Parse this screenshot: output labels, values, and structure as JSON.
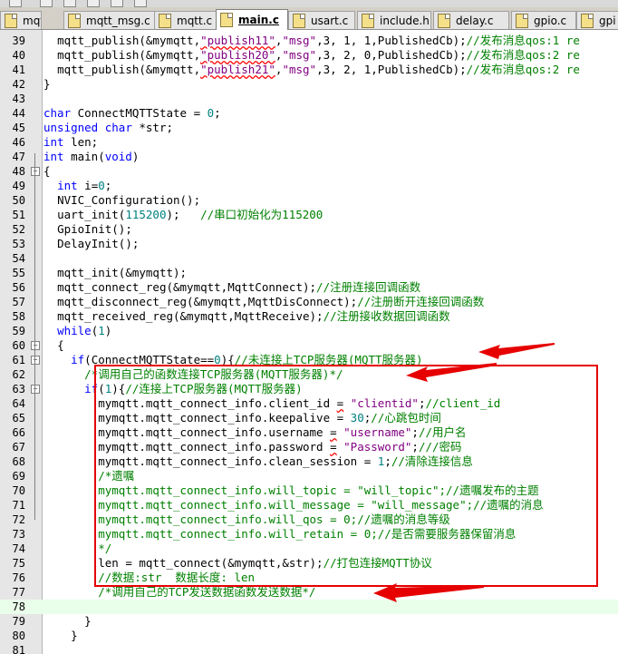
{
  "tabs": [
    {
      "label": "mqtt.h",
      "active": false
    },
    {
      "label": "mqtt_msg.c",
      "active": false
    },
    {
      "label": "mqtt.c",
      "active": false
    },
    {
      "label": "main.c",
      "active": true
    },
    {
      "label": "usart.c",
      "active": false
    },
    {
      "label": "include.h",
      "active": false
    },
    {
      "label": "delay.c",
      "active": false
    },
    {
      "label": "gpio.c",
      "active": false
    },
    {
      "label": "gpi",
      "active": false
    }
  ],
  "file_icon_color": "#f5e08a",
  "accent_color": "#e60000",
  "current_line": 78,
  "lines": [
    {
      "n": "39",
      "indent": "  ",
      "tokens": [
        [
          "mqtt_publish(&mymqtt,",
          ""
        ],
        [
          "\"publish11\"",
          "str sq"
        ],
        [
          ",",
          ""
        ],
        [
          "\"msg\"",
          "str"
        ],
        [
          ",3, 1, 1,PublishedCb);",
          ""
        ],
        [
          "//发布消息qos:1 re",
          "cm"
        ]
      ]
    },
    {
      "n": "40",
      "indent": "  ",
      "tokens": [
        [
          "mqtt_publish(&mymqtt,",
          ""
        ],
        [
          "\"publish20\"",
          "str sq"
        ],
        [
          ",",
          ""
        ],
        [
          "\"msg\"",
          "str"
        ],
        [
          ",3, 2, 0,PublishedCb);",
          ""
        ],
        [
          "//发布消息qos:2 re",
          "cm"
        ]
      ]
    },
    {
      "n": "41",
      "indent": "  ",
      "tokens": [
        [
          "mqtt_publish(&mymqtt,",
          ""
        ],
        [
          "\"publish21\"",
          "str sq"
        ],
        [
          ",",
          ""
        ],
        [
          "\"msg\"",
          "str"
        ],
        [
          ",3, 2, 1,PublishedCb);",
          ""
        ],
        [
          "//发布消息qos:2 re",
          "cm"
        ]
      ]
    },
    {
      "n": "42",
      "indent": "",
      "tokens": [
        [
          "}",
          ""
        ]
      ]
    },
    {
      "n": "43",
      "indent": "",
      "tokens": []
    },
    {
      "n": "44",
      "indent": "",
      "tokens": [
        [
          "char",
          "kw"
        ],
        [
          " ConnectMQTTState = ",
          ""
        ],
        [
          "0",
          "num"
        ],
        [
          ";",
          ""
        ]
      ]
    },
    {
      "n": "45",
      "indent": "",
      "tokens": [
        [
          "unsigned",
          "kw"
        ],
        [
          " ",
          ""
        ],
        [
          "char",
          "kw"
        ],
        [
          " *str;",
          ""
        ]
      ]
    },
    {
      "n": "46",
      "indent": "",
      "tokens": [
        [
          "int",
          "kw"
        ],
        [
          " len;",
          ""
        ]
      ]
    },
    {
      "n": "47",
      "indent": "",
      "tokens": [
        [
          "int",
          "kw"
        ],
        [
          " main(",
          ""
        ],
        [
          "void",
          "kw"
        ],
        [
          ")",
          ""
        ]
      ]
    },
    {
      "n": "48",
      "indent": "",
      "tokens": [
        [
          "{",
          ""
        ]
      ]
    },
    {
      "n": "49",
      "indent": "  ",
      "tokens": [
        [
          "int",
          "kw"
        ],
        [
          " i=",
          ""
        ],
        [
          "0",
          "num"
        ],
        [
          ";",
          ""
        ]
      ]
    },
    {
      "n": "50",
      "indent": "  ",
      "tokens": [
        [
          "NVIC_Configuration();",
          ""
        ]
      ]
    },
    {
      "n": "51",
      "indent": "  ",
      "tokens": [
        [
          "uart_init(",
          ""
        ],
        [
          "115200",
          "num"
        ],
        [
          ");   ",
          ""
        ],
        [
          "//串口初始化为115200",
          "cm"
        ]
      ]
    },
    {
      "n": "52",
      "indent": "  ",
      "tokens": [
        [
          "GpioInit();",
          ""
        ]
      ]
    },
    {
      "n": "53",
      "indent": "  ",
      "tokens": [
        [
          "DelayInit();",
          ""
        ]
      ]
    },
    {
      "n": "54",
      "indent": "",
      "tokens": []
    },
    {
      "n": "55",
      "indent": "  ",
      "tokens": [
        [
          "mqtt_init(&mymqtt);",
          ""
        ]
      ]
    },
    {
      "n": "56",
      "indent": "  ",
      "tokens": [
        [
          "mqtt_connect_reg(&mymqtt,MqttConnect);",
          ""
        ],
        [
          "//注册连接回调函数",
          "cm"
        ]
      ]
    },
    {
      "n": "57",
      "indent": "  ",
      "tokens": [
        [
          "mqtt_disconnect_reg(&mymqtt,MqttDisConnect);",
          ""
        ],
        [
          "//注册断开连接回调函数",
          "cm"
        ]
      ]
    },
    {
      "n": "58",
      "indent": "  ",
      "tokens": [
        [
          "mqtt_received_reg(&mymqtt,MqttReceive);",
          ""
        ],
        [
          "//注册接收数据回调函数",
          "cm"
        ]
      ]
    },
    {
      "n": "59",
      "indent": "  ",
      "tokens": [
        [
          "while",
          "kw"
        ],
        [
          "(",
          ""
        ],
        [
          "1",
          "num"
        ],
        [
          ")",
          ""
        ]
      ]
    },
    {
      "n": "60",
      "indent": "  ",
      "tokens": [
        [
          "{",
          ""
        ]
      ]
    },
    {
      "n": "61",
      "indent": "    ",
      "tokens": [
        [
          "if",
          "kw"
        ],
        [
          "(ConnectMQTTState==",
          ""
        ],
        [
          "0",
          "num"
        ],
        [
          "){",
          ""
        ],
        [
          "//未连接上TCP服务器(MQTT服务器)",
          "cm"
        ]
      ]
    },
    {
      "n": "62",
      "indent": "      ",
      "tokens": [
        [
          "/*调用自己的函数连接TCP服务器(MQTT服务器)*/",
          "cm"
        ]
      ]
    },
    {
      "n": "63",
      "indent": "      ",
      "tokens": [
        [
          "if",
          "kw"
        ],
        [
          "(",
          ""
        ],
        [
          "1",
          "num"
        ],
        [
          "){",
          ""
        ],
        [
          "//连接上TCP服务器(MQTT服务器)",
          "cm"
        ]
      ]
    },
    {
      "n": "64",
      "indent": "        ",
      "tokens": [
        [
          "mymqtt.mqtt_connect_info.client_id ",
          ""
        ],
        [
          "=",
          "sq"
        ],
        [
          " ",
          ""
        ],
        [
          "\"clientid\"",
          "str"
        ],
        [
          ";",
          ""
        ],
        [
          "//client_id",
          "cm"
        ]
      ]
    },
    {
      "n": "65",
      "indent": "        ",
      "tokens": [
        [
          "mymqtt.mqtt_connect_info.keepalive = ",
          ""
        ],
        [
          "30",
          "num"
        ],
        [
          ";",
          ""
        ],
        [
          "//心跳包时间",
          "cm"
        ]
      ]
    },
    {
      "n": "66",
      "indent": "        ",
      "tokens": [
        [
          "mymqtt.mqtt_connect_info.username ",
          ""
        ],
        [
          "=",
          "sq"
        ],
        [
          " ",
          ""
        ],
        [
          "\"username\"",
          "str"
        ],
        [
          ";",
          ""
        ],
        [
          "//用户名",
          "cm"
        ]
      ]
    },
    {
      "n": "67",
      "indent": "        ",
      "tokens": [
        [
          "mymqtt.mqtt_connect_info.password ",
          ""
        ],
        [
          "=",
          "sq"
        ],
        [
          " ",
          ""
        ],
        [
          "\"Password\"",
          "str"
        ],
        [
          ";",
          ""
        ],
        [
          "///密码",
          "cm"
        ]
      ]
    },
    {
      "n": "68",
      "indent": "        ",
      "tokens": [
        [
          "mymqtt.mqtt_connect_info.clean_session = ",
          ""
        ],
        [
          "1",
          "num"
        ],
        [
          ";",
          ""
        ],
        [
          "//清除连接信息",
          "cm"
        ]
      ]
    },
    {
      "n": "69",
      "indent": "        ",
      "tokens": [
        [
          "/*遗嘱",
          "cm"
        ]
      ]
    },
    {
      "n": "70",
      "indent": "        ",
      "tokens": [
        [
          "mymqtt.mqtt_connect_info.will_topic = \"will_topic\";//遗嘱发布的主题",
          "cm"
        ]
      ]
    },
    {
      "n": "71",
      "indent": "        ",
      "tokens": [
        [
          "mymqtt.mqtt_connect_info.will_message = \"will_message\";//遗嘱的消息",
          "cm"
        ]
      ]
    },
    {
      "n": "72",
      "indent": "        ",
      "tokens": [
        [
          "mymqtt.mqtt_connect_info.will_qos = 0;//遗嘱的消息等级",
          "cm"
        ]
      ]
    },
    {
      "n": "73",
      "indent": "        ",
      "tokens": [
        [
          "mymqtt.mqtt_connect_info.will_retain = 0;//是否需要服务器保留消息",
          "cm"
        ]
      ]
    },
    {
      "n": "74",
      "indent": "        ",
      "tokens": [
        [
          "*/",
          "cm"
        ]
      ]
    },
    {
      "n": "75",
      "indent": "        ",
      "tokens": [
        [
          "len = mqtt_connect(&mymqtt,&str);",
          ""
        ],
        [
          "//打包连接MQTT协议",
          "cm"
        ]
      ]
    },
    {
      "n": "76",
      "indent": "        ",
      "tokens": [
        [
          "//数据:str  数据长度: len",
          "cm"
        ]
      ]
    },
    {
      "n": "77",
      "indent": "        ",
      "tokens": [
        [
          "/*调用自己的TCP发送数据函数发送数据*/",
          "cm"
        ]
      ]
    },
    {
      "n": "78",
      "indent": "",
      "tokens": []
    },
    {
      "n": "79",
      "indent": "      ",
      "tokens": [
        [
          "}",
          ""
        ]
      ]
    },
    {
      "n": "80",
      "indent": "    ",
      "tokens": [
        [
          "}",
          ""
        ]
      ]
    },
    {
      "n": "81",
      "indent": "",
      "tokens": []
    }
  ]
}
